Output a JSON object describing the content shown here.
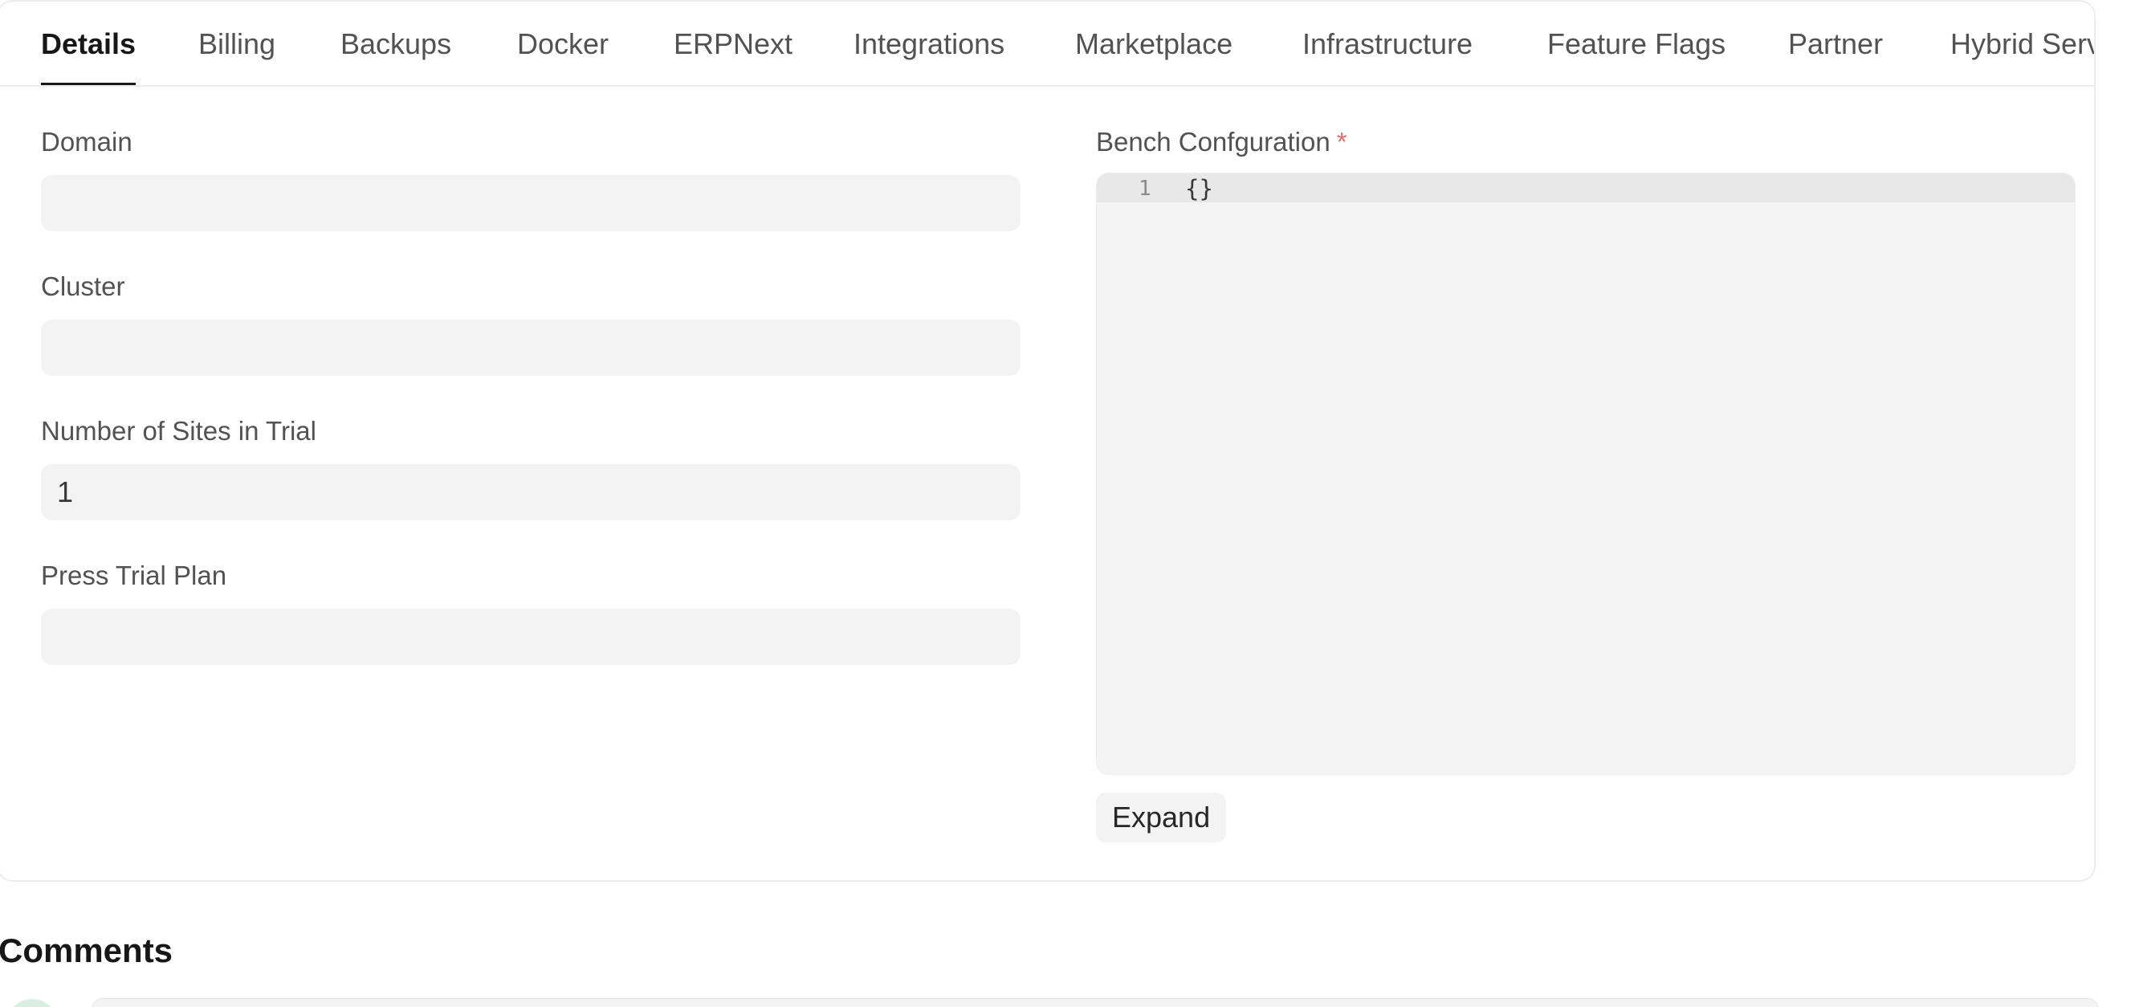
{
  "tabs": [
    {
      "label": "Details",
      "active": true
    },
    {
      "label": "Billing",
      "active": false
    },
    {
      "label": "Backups",
      "active": false
    },
    {
      "label": "Docker",
      "active": false
    },
    {
      "label": "ERPNext",
      "active": false
    },
    {
      "label": "Integrations",
      "active": false
    },
    {
      "label": "Marketplace",
      "active": false
    },
    {
      "label": "Infrastructure",
      "active": false
    },
    {
      "label": "Feature Flags",
      "active": false
    },
    {
      "label": "Partner",
      "active": false
    },
    {
      "label": "Hybrid Server",
      "active": false
    }
  ],
  "form": {
    "domain": {
      "label": "Domain",
      "value": ""
    },
    "cluster": {
      "label": "Cluster",
      "value": ""
    },
    "trial_sites": {
      "label": "Number of Sites in Trial",
      "value": "1"
    },
    "trial_plan": {
      "label": "Press Trial Plan",
      "value": ""
    },
    "bench_config": {
      "label": "Bench Confguration",
      "required_mark": "*",
      "line_number": "1",
      "code": "{}",
      "expand_label": "Expand"
    }
  },
  "comments": {
    "title": "Comments"
  },
  "colors": {
    "accent": "#171717",
    "required": "#e36a6a",
    "field_bg": "#f3f3f3"
  }
}
